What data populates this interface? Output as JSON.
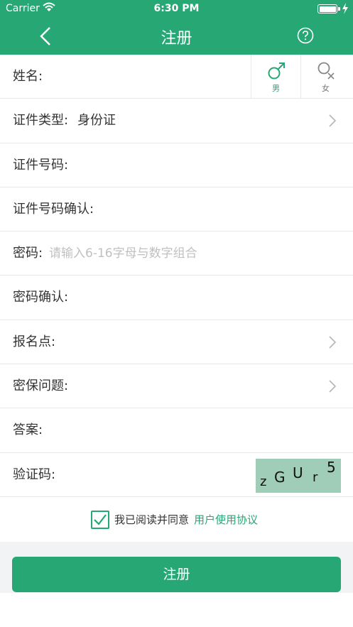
{
  "status_bar": {
    "carrier": "Carrier",
    "time": "6:30 PM",
    "battery_level": 1.0
  },
  "nav": {
    "title": "注册",
    "back_icon": "chevron-left-icon",
    "help_icon": "question-circle-icon"
  },
  "form": {
    "name": {
      "label": "姓名:",
      "male_label": "男",
      "female_label": "女",
      "selected_gender": "男"
    },
    "id_type": {
      "label": "证件类型:",
      "value": "身份证"
    },
    "id_number": {
      "label": "证件号码:"
    },
    "id_confirm": {
      "label": "证件号码确认:"
    },
    "password": {
      "label": "密码:",
      "placeholder": "请输入6-16字母与数字组合"
    },
    "password_confirm": {
      "label": "密码确认:"
    },
    "signup_point": {
      "label": "报名点:"
    },
    "security_question": {
      "label": "密保问题:"
    },
    "answer": {
      "label": "答案:"
    },
    "captcha": {
      "label": "验证码:",
      "chars": [
        "z",
        "G",
        "U",
        "r",
        "5"
      ]
    }
  },
  "agreement": {
    "checked": true,
    "text": "我已阅读并同意",
    "link": "用户使用协议"
  },
  "submit": {
    "label": "注册"
  },
  "colors": {
    "accent": "#26a774",
    "captcha_bg": "#9fcdb8"
  }
}
